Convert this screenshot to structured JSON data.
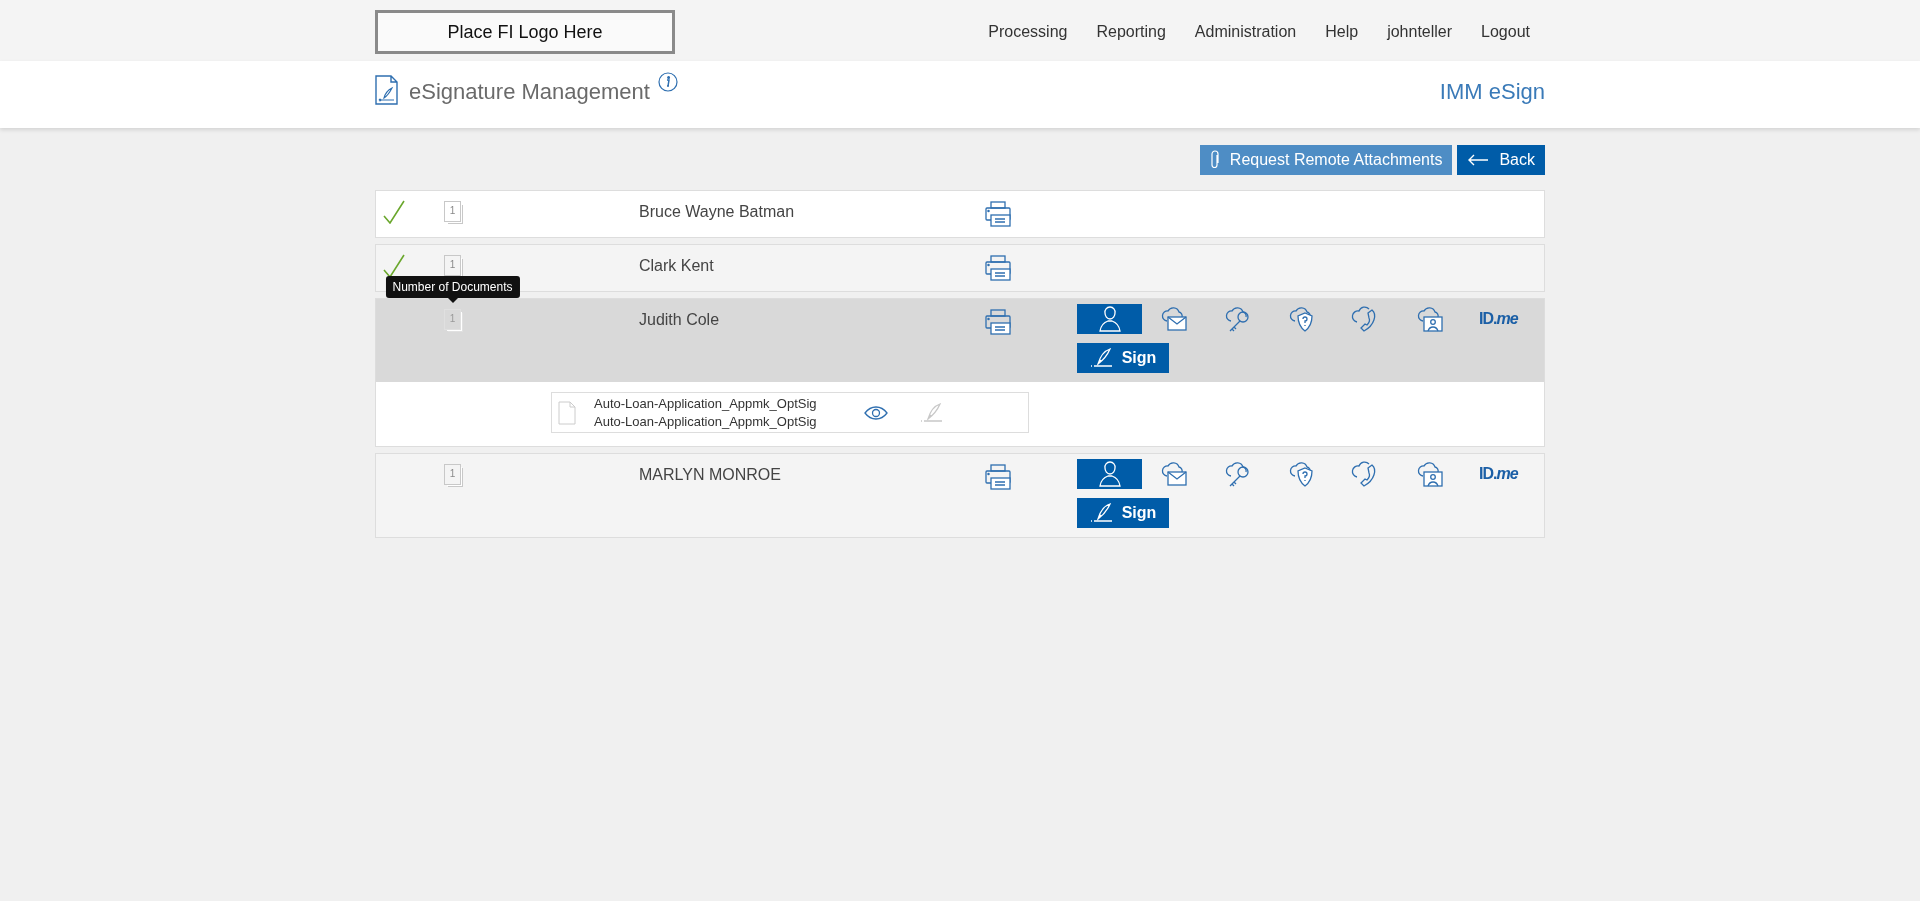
{
  "logo": "Place FI Logo Here",
  "nav": [
    "Processing",
    "Reporting",
    "Administration",
    "Help",
    "johnteller",
    "Logout"
  ],
  "page_title": "eSignature Management",
  "app_name": "IMM eSign",
  "actions": [
    {
      "kind": "attach",
      "label": "Request Remote Attachments"
    },
    {
      "kind": "back",
      "label": "Back"
    }
  ],
  "rows": [
    {
      "name": "Bruce Wayne Batman",
      "signed": true,
      "doc_count": "1",
      "selected": false,
      "expanded": false
    },
    {
      "name": "Clark Kent",
      "signed": true,
      "doc_count": "1",
      "selected": false,
      "expanded": false
    },
    {
      "name": "Judith Cole",
      "signed": false,
      "doc_count": "1",
      "selected": true,
      "expanded": true,
      "tooltip": "Number of Documents",
      "sign_label": "Sign",
      "methods": [
        {
          "kind": "person",
          "selected": true
        },
        {
          "kind": "cloud-mail",
          "selected": false
        },
        {
          "kind": "cloud-key",
          "selected": false
        },
        {
          "kind": "cloud-shield",
          "selected": false
        },
        {
          "kind": "cloud-phone",
          "selected": false
        },
        {
          "kind": "cloud-video",
          "selected": false
        },
        {
          "kind": "idme",
          "label": "ID.*me*",
          "selected": false
        }
      ],
      "documents": [
        {
          "name": "Auto-Loan-Application_Appmk_OptSig",
          "detail": "Auto-Loan-Application_Appmk_OptSig",
          "sign_disabled": true
        }
      ]
    },
    {
      "name": "MARLYN MONROE",
      "signed": false,
      "doc_count": "1",
      "selected": false,
      "expanded": false,
      "sign_label": "Sign",
      "methods": [
        {
          "kind": "person",
          "selected": true
        },
        {
          "kind": "cloud-mail",
          "selected": false
        },
        {
          "kind": "cloud-key",
          "selected": false
        },
        {
          "kind": "cloud-shield",
          "selected": false
        },
        {
          "kind": "cloud-phone",
          "selected": false
        },
        {
          "kind": "cloud-video",
          "selected": false
        },
        {
          "kind": "idme",
          "label": "ID.*me*",
          "selected": false
        }
      ]
    }
  ]
}
